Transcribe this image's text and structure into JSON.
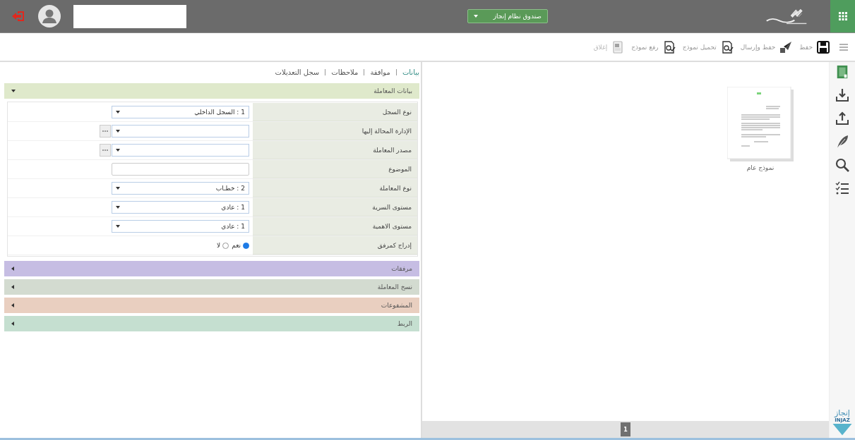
{
  "header": {
    "system_menu": "صندوق نظام إنجاز"
  },
  "toolbar": [
    {
      "kind": "save",
      "label": "حفظ",
      "disabled": false
    },
    {
      "kind": "send",
      "label": "حفظ وإرسال",
      "disabled": false
    },
    {
      "kind": "download",
      "label": "تحميل نموذج",
      "disabled": false
    },
    {
      "kind": "upload",
      "label": "رفع نموذج",
      "disabled": false
    },
    {
      "kind": "close",
      "label": "إغلاق",
      "disabled": true
    }
  ],
  "tabs": [
    {
      "label": "بيانات",
      "selected": true
    },
    {
      "label": "موافقة",
      "selected": false
    },
    {
      "label": "ملاحظات",
      "selected": false
    },
    {
      "label": "سجل التعديلات",
      "selected": false
    }
  ],
  "sections": [
    {
      "title": "بيانات المعاملة",
      "color": "#dfe9cb",
      "expanded": true
    },
    {
      "title": "مرفقات",
      "color": "#c6bde3",
      "expanded": false
    },
    {
      "title": "نسخ المعاملة",
      "color": "#d3dbd0",
      "expanded": false
    },
    {
      "title": "المشفوعات",
      "color": "#e9cfc0",
      "expanded": false
    },
    {
      "title": "الربط",
      "color": "#c5dfd0",
      "expanded": false
    }
  ],
  "form": [
    {
      "label": "نوع السجل",
      "kind": "select",
      "value": "1 : السجل الداخلي"
    },
    {
      "label": "الإدارة المحالة إليها",
      "kind": "lookup"
    },
    {
      "label": "مصدر المعاملة",
      "kind": "lookup"
    },
    {
      "label": "الموضوع",
      "kind": "textarea"
    },
    {
      "label": "نوع المعاملة",
      "kind": "select",
      "value": "2 : خطـاب"
    },
    {
      "label": "مستوى السرية",
      "kind": "select",
      "value": "1 : عادي"
    },
    {
      "label": "مستوى الاهمية",
      "kind": "select",
      "value": "1 : عادي"
    },
    {
      "label": "إدراج كمرفق",
      "kind": "radio",
      "options": [
        {
          "label": "نعم",
          "selected": true
        },
        {
          "label": "لا",
          "selected": false
        }
      ]
    }
  ],
  "viewer": {
    "templates": [
      {
        "caption": "نموذج عام"
      }
    ],
    "pages": [
      {
        "label": "1",
        "selected": true
      }
    ]
  },
  "brand": {
    "arabic": "إنجاز",
    "latin": "INJAZ"
  }
}
